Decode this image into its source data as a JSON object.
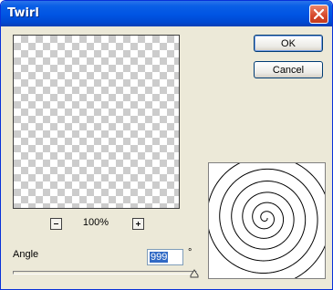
{
  "window": {
    "title": "Twirl"
  },
  "buttons": {
    "ok_label": "OK",
    "cancel_label": "Cancel"
  },
  "preview": {
    "zoom_level": "100%"
  },
  "angle": {
    "label": "Angle",
    "value": "999",
    "unit": "°",
    "slider_fraction": 1.0
  },
  "icons": {
    "close": "close-icon",
    "zoom_out": "minus-icon",
    "zoom_in": "plus-icon",
    "slider_thumb": "slider-thumb-icon",
    "twirl_preview": "spiral-icon"
  },
  "colors": {
    "titlebar": "#0054e3",
    "dialog_bg": "#ece9d8",
    "selection": "#316ac5"
  }
}
